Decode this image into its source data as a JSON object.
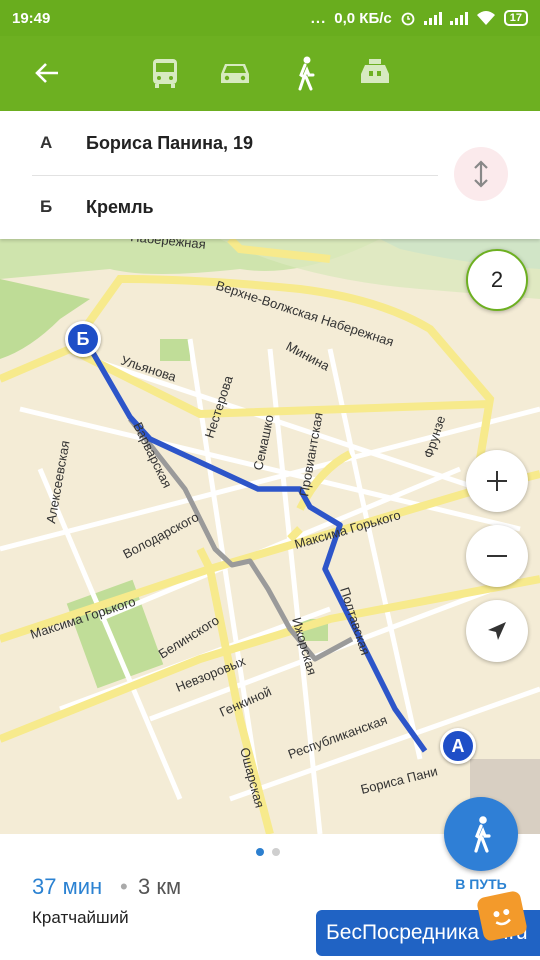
{
  "status_bar": {
    "time": "19:49",
    "dots": "...",
    "network_speed": "0,0 КБ/с",
    "battery": "17"
  },
  "transport_modes": [
    {
      "icon": "bus-icon"
    },
    {
      "icon": "car-icon"
    },
    {
      "icon": "walk-icon"
    },
    {
      "icon": "taxi-icon"
    }
  ],
  "route": {
    "from": {
      "letter": "А",
      "address": "Бориса Панина, 19"
    },
    "to": {
      "letter": "Б",
      "address": "Кремль"
    }
  },
  "map": {
    "layers_count": "2",
    "marker_a": "А",
    "marker_b": "Б",
    "streets": [
      "Верхне-Волжская Набережная",
      "Ульянова",
      "Нестерова",
      "Минина",
      "Семашко",
      "Провиантская",
      "Фрунзе",
      "Алексеевская",
      "Варварская",
      "Володарского",
      "Максима Горького",
      "Максима Горького",
      "Белинского",
      "Невзоровых",
      "Ижорская",
      "Полтавская",
      "Генкиной",
      "Республиканская",
      "Бориса Пани",
      "Ошарская",
      "Набережная"
    ],
    "route_color": "#2d55c9",
    "alt_route_color": "#9a9a9a"
  },
  "summary": {
    "duration": "37 мин",
    "separator": "•",
    "distance": "3 км",
    "route_type": "Кратчайший"
  },
  "go_button": {
    "label": "В ПУТЬ"
  },
  "watermark": {
    "text": "БесПосредника",
    "suffix": ".ru"
  }
}
